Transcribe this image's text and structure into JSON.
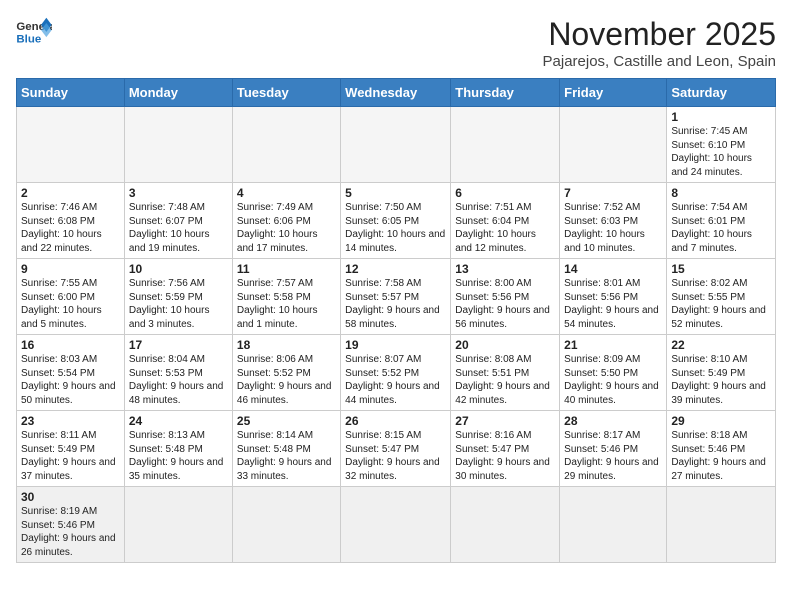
{
  "header": {
    "logo_general": "General",
    "logo_blue": "Blue",
    "month_title": "November 2025",
    "subtitle": "Pajarejos, Castille and Leon, Spain"
  },
  "days_of_week": [
    "Sunday",
    "Monday",
    "Tuesday",
    "Wednesday",
    "Thursday",
    "Friday",
    "Saturday"
  ],
  "weeks": [
    [
      {
        "day": "",
        "info": ""
      },
      {
        "day": "",
        "info": ""
      },
      {
        "day": "",
        "info": ""
      },
      {
        "day": "",
        "info": ""
      },
      {
        "day": "",
        "info": ""
      },
      {
        "day": "",
        "info": ""
      },
      {
        "day": "1",
        "info": "Sunrise: 7:45 AM\nSunset: 6:10 PM\nDaylight: 10 hours and 24 minutes."
      }
    ],
    [
      {
        "day": "2",
        "info": "Sunrise: 7:46 AM\nSunset: 6:08 PM\nDaylight: 10 hours and 22 minutes."
      },
      {
        "day": "3",
        "info": "Sunrise: 7:48 AM\nSunset: 6:07 PM\nDaylight: 10 hours and 19 minutes."
      },
      {
        "day": "4",
        "info": "Sunrise: 7:49 AM\nSunset: 6:06 PM\nDaylight: 10 hours and 17 minutes."
      },
      {
        "day": "5",
        "info": "Sunrise: 7:50 AM\nSunset: 6:05 PM\nDaylight: 10 hours and 14 minutes."
      },
      {
        "day": "6",
        "info": "Sunrise: 7:51 AM\nSunset: 6:04 PM\nDaylight: 10 hours and 12 minutes."
      },
      {
        "day": "7",
        "info": "Sunrise: 7:52 AM\nSunset: 6:03 PM\nDaylight: 10 hours and 10 minutes."
      },
      {
        "day": "8",
        "info": "Sunrise: 7:54 AM\nSunset: 6:01 PM\nDaylight: 10 hours and 7 minutes."
      }
    ],
    [
      {
        "day": "9",
        "info": "Sunrise: 7:55 AM\nSunset: 6:00 PM\nDaylight: 10 hours and 5 minutes."
      },
      {
        "day": "10",
        "info": "Sunrise: 7:56 AM\nSunset: 5:59 PM\nDaylight: 10 hours and 3 minutes."
      },
      {
        "day": "11",
        "info": "Sunrise: 7:57 AM\nSunset: 5:58 PM\nDaylight: 10 hours and 1 minute."
      },
      {
        "day": "12",
        "info": "Sunrise: 7:58 AM\nSunset: 5:57 PM\nDaylight: 9 hours and 58 minutes."
      },
      {
        "day": "13",
        "info": "Sunrise: 8:00 AM\nSunset: 5:56 PM\nDaylight: 9 hours and 56 minutes."
      },
      {
        "day": "14",
        "info": "Sunrise: 8:01 AM\nSunset: 5:56 PM\nDaylight: 9 hours and 54 minutes."
      },
      {
        "day": "15",
        "info": "Sunrise: 8:02 AM\nSunset: 5:55 PM\nDaylight: 9 hours and 52 minutes."
      }
    ],
    [
      {
        "day": "16",
        "info": "Sunrise: 8:03 AM\nSunset: 5:54 PM\nDaylight: 9 hours and 50 minutes."
      },
      {
        "day": "17",
        "info": "Sunrise: 8:04 AM\nSunset: 5:53 PM\nDaylight: 9 hours and 48 minutes."
      },
      {
        "day": "18",
        "info": "Sunrise: 8:06 AM\nSunset: 5:52 PM\nDaylight: 9 hours and 46 minutes."
      },
      {
        "day": "19",
        "info": "Sunrise: 8:07 AM\nSunset: 5:52 PM\nDaylight: 9 hours and 44 minutes."
      },
      {
        "day": "20",
        "info": "Sunrise: 8:08 AM\nSunset: 5:51 PM\nDaylight: 9 hours and 42 minutes."
      },
      {
        "day": "21",
        "info": "Sunrise: 8:09 AM\nSunset: 5:50 PM\nDaylight: 9 hours and 40 minutes."
      },
      {
        "day": "22",
        "info": "Sunrise: 8:10 AM\nSunset: 5:49 PM\nDaylight: 9 hours and 39 minutes."
      }
    ],
    [
      {
        "day": "23",
        "info": "Sunrise: 8:11 AM\nSunset: 5:49 PM\nDaylight: 9 hours and 37 minutes."
      },
      {
        "day": "24",
        "info": "Sunrise: 8:13 AM\nSunset: 5:48 PM\nDaylight: 9 hours and 35 minutes."
      },
      {
        "day": "25",
        "info": "Sunrise: 8:14 AM\nSunset: 5:48 PM\nDaylight: 9 hours and 33 minutes."
      },
      {
        "day": "26",
        "info": "Sunrise: 8:15 AM\nSunset: 5:47 PM\nDaylight: 9 hours and 32 minutes."
      },
      {
        "day": "27",
        "info": "Sunrise: 8:16 AM\nSunset: 5:47 PM\nDaylight: 9 hours and 30 minutes."
      },
      {
        "day": "28",
        "info": "Sunrise: 8:17 AM\nSunset: 5:46 PM\nDaylight: 9 hours and 29 minutes."
      },
      {
        "day": "29",
        "info": "Sunrise: 8:18 AM\nSunset: 5:46 PM\nDaylight: 9 hours and 27 minutes."
      }
    ],
    [
      {
        "day": "30",
        "info": "Sunrise: 8:19 AM\nSunset: 5:46 PM\nDaylight: 9 hours and 26 minutes."
      },
      {
        "day": "",
        "info": ""
      },
      {
        "day": "",
        "info": ""
      },
      {
        "day": "",
        "info": ""
      },
      {
        "day": "",
        "info": ""
      },
      {
        "day": "",
        "info": ""
      },
      {
        "day": "",
        "info": ""
      }
    ]
  ]
}
